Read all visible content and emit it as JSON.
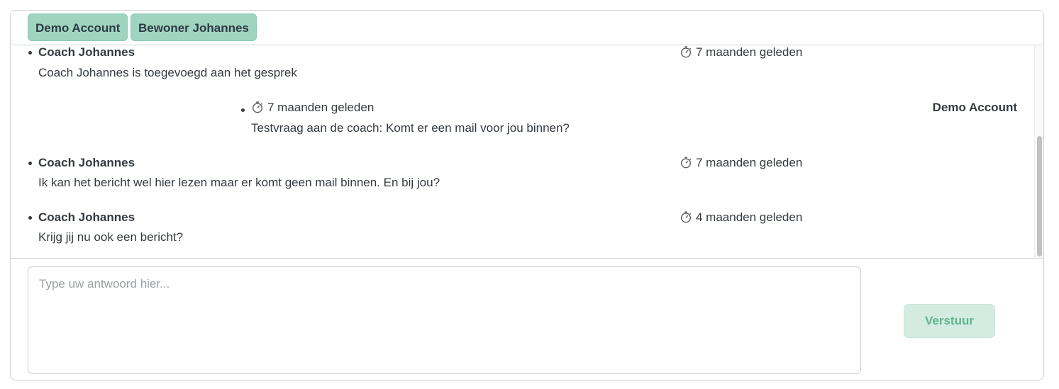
{
  "header": {
    "participants": [
      "Demo Account",
      "Bewoner Johannes"
    ]
  },
  "messages": [
    {
      "author": "Coach Johannes",
      "time": "7 maanden geleden",
      "text": "Coach Johannes is toegevoegd aan het gesprek",
      "own": false
    },
    {
      "author": "Demo Account",
      "time": "7 maanden geleden",
      "text": "Testvraag aan de coach: Komt er een mail voor jou binnen?",
      "own": true
    },
    {
      "author": "Coach Johannes",
      "time": "7 maanden geleden",
      "text": "Ik kan het bericht wel hier lezen maar er komt geen mail binnen. En bij jou?",
      "own": false
    },
    {
      "author": "Coach Johannes",
      "time": "4 maanden geleden",
      "text": "Krijg jij nu ook een bericht?",
      "own": false
    }
  ],
  "composer": {
    "placeholder": "Type uw antwoord hier...",
    "value": "",
    "send_label": "Verstuur"
  },
  "icons": {
    "timestamp": "stopwatch-icon"
  },
  "colors": {
    "participant_bg": "#9ed4c0",
    "send_bg": "#d3ebe1",
    "send_text": "#5fb48f"
  }
}
